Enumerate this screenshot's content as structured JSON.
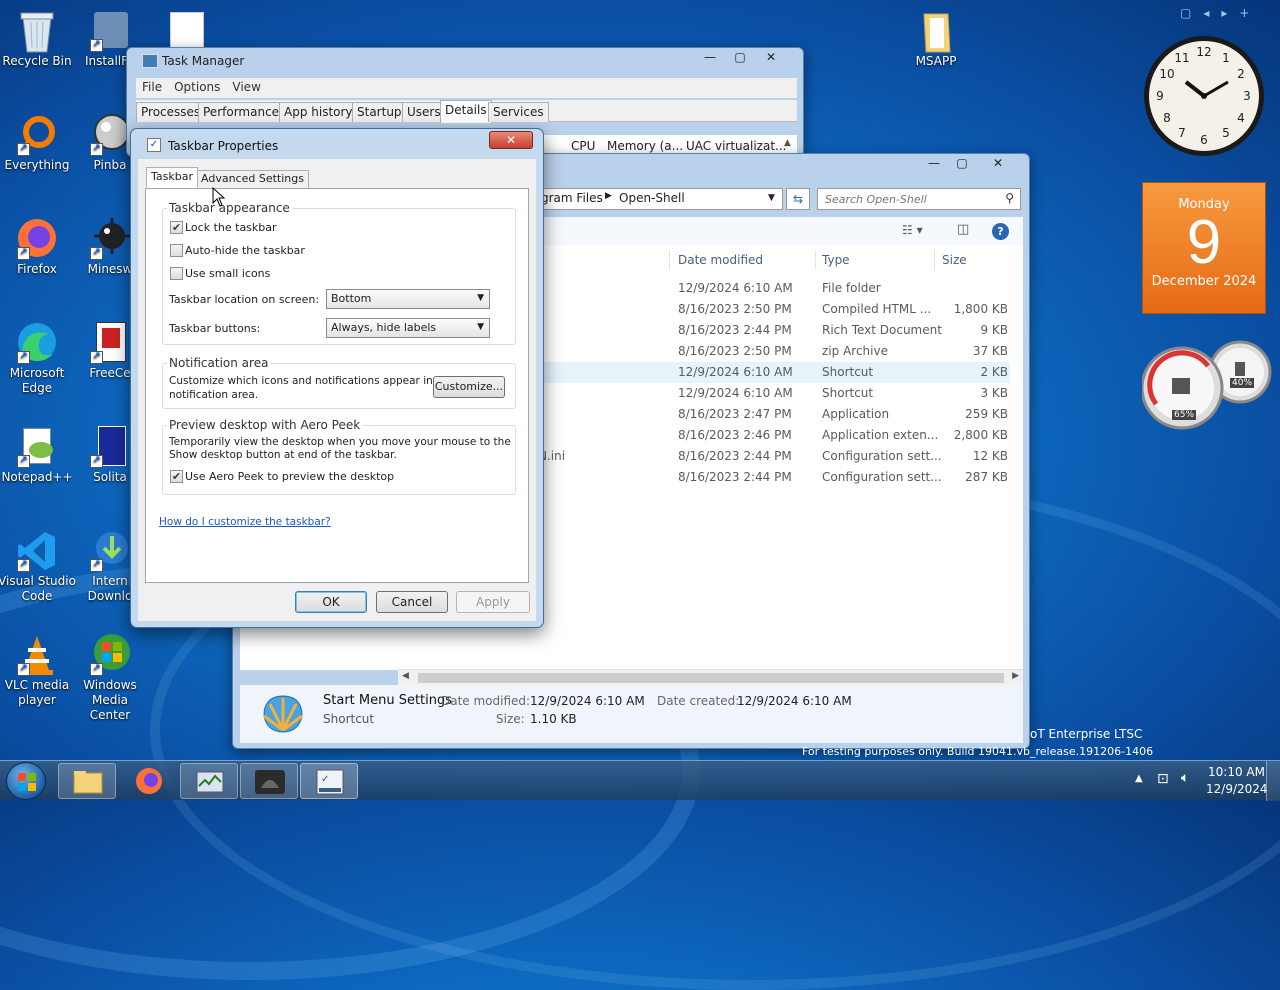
{
  "desktop": {
    "icons": [
      {
        "label": "Recycle Bin"
      },
      {
        "label": "InstallFo"
      },
      {
        "label": "Everything"
      },
      {
        "label": "Pinba"
      },
      {
        "label": "Firefox"
      },
      {
        "label": "Minesw"
      },
      {
        "label": "Microsoft Edge"
      },
      {
        "label": "FreeCe"
      },
      {
        "label": "Notepad++"
      },
      {
        "label": "Solita"
      },
      {
        "label": "Visual Studio Code"
      },
      {
        "label": "Intern Downlo"
      },
      {
        "label": "VLC media player"
      },
      {
        "label": "Windows Media Center"
      },
      {
        "label": "MSAPP"
      }
    ],
    "watermark_line1": "oT Enterprise LTSC",
    "watermark_line2": "For testing purposes only. Build 19041.vb_release.191206-1406"
  },
  "calendar": {
    "day_name": "Monday",
    "day": "9",
    "month_year": "December 2024"
  },
  "meter": {
    "cpu": "65%",
    "memory": "40%"
  },
  "task_manager": {
    "title": "Task Manager",
    "menu": [
      "File",
      "Options",
      "View"
    ],
    "tabs": [
      "Processes",
      "Performance",
      "App history",
      "Startup",
      "Users",
      "Details",
      "Services"
    ],
    "active_tab": "Details",
    "columns": [
      "CPU",
      "Memory (a...",
      "UAC virtualizat..."
    ]
  },
  "explorer": {
    "path": [
      "gram Files",
      "Open-Shell"
    ],
    "search_placeholder": "Search Open-Shell",
    "columns": [
      "Date modified",
      "Type",
      "Size"
    ],
    "rows": [
      {
        "name": "",
        "date": "12/9/2024 6:10 AM",
        "type": "File folder",
        "size": ""
      },
      {
        "name": "",
        "date": "8/16/2023 2:50 PM",
        "type": "Compiled HTML ...",
        "size": "1,800 KB"
      },
      {
        "name": "f",
        "date": "8/16/2023 2:44 PM",
        "type": "Rich Text Document",
        "size": "9 KB"
      },
      {
        "name": "",
        "date": "8/16/2023 2:50 PM",
        "type": "zip Archive",
        "size": "37 KB"
      },
      {
        "name": "",
        "date": "12/9/2024 6:10 AM",
        "type": "Shortcut",
        "size": "2 KB"
      },
      {
        "name": "",
        "date": "12/9/2024 6:10 AM",
        "type": "Shortcut",
        "size": "3 KB"
      },
      {
        "name": "",
        "date": "8/16/2023 2:47 PM",
        "type": "Application",
        "size": "259 KB"
      },
      {
        "name": "",
        "date": "8/16/2023 2:46 PM",
        "type": "Application exten...",
        "size": "2,800 KB"
      },
      {
        "name": "N.ini",
        "date": "8/16/2023 2:44 PM",
        "type": "Configuration sett...",
        "size": "12 KB"
      },
      {
        "name": "",
        "date": "8/16/2023 2:44 PM",
        "type": "Configuration sett...",
        "size": "287 KB"
      }
    ],
    "details": {
      "name": "Start Menu Settings",
      "kind": "Shortcut",
      "date_modified_label": "Date modified:",
      "date_modified": "12/9/2024 6:10 AM",
      "date_created_label": "Date created:",
      "date_created": "12/9/2024 6:10 AM",
      "size_label": "Size:",
      "size": "1.10 KB"
    }
  },
  "dialog": {
    "title": "Taskbar Properties",
    "tabs": [
      "Taskbar",
      "Advanced Settings"
    ],
    "appearance": {
      "legend": "Taskbar appearance",
      "lock": "Lock the taskbar",
      "autohide": "Auto-hide the taskbar",
      "small_icons": "Use small icons",
      "location_label": "Taskbar location on screen:",
      "location_value": "Bottom",
      "buttons_label": "Taskbar buttons:",
      "buttons_value": "Always, hide labels"
    },
    "notification": {
      "legend": "Notification area",
      "text1": "Customize which icons and notifications appear in the",
      "text2": "notification area.",
      "button": "Customize..."
    },
    "peek": {
      "legend": "Preview desktop with Aero Peek",
      "text1": "Temporarily view the desktop when you move your mouse to the",
      "text2": "Show desktop button at end of the taskbar.",
      "checkbox": "Use Aero Peek to preview the desktop"
    },
    "help_link": "How do I customize the taskbar?",
    "ok": "OK",
    "cancel": "Cancel",
    "apply": "Apply"
  },
  "taskbar": {
    "time": "10:10 AM",
    "date": "12/9/2024"
  }
}
